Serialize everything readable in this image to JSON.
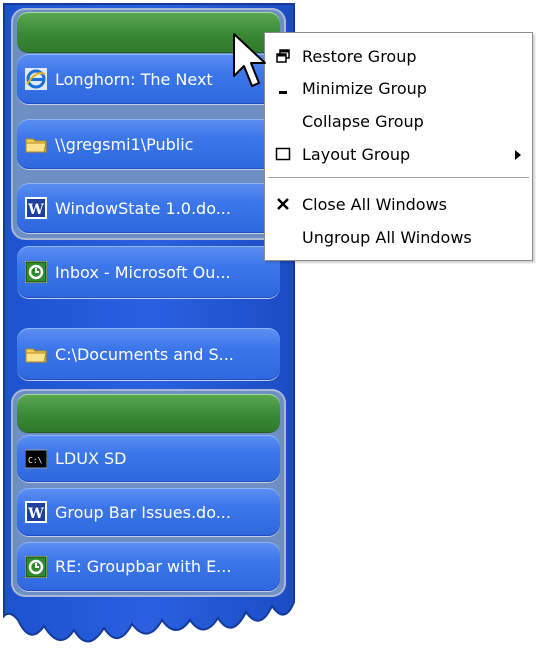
{
  "colors": {
    "taskbar_blue": "#2f68de",
    "group_header_green": "#3a8a35",
    "menu_background": "#ffffff"
  },
  "group_1": {
    "header_label": "",
    "windows": [
      {
        "icon": "internet-explorer-icon",
        "title": "Longhorn: The Next"
      },
      {
        "icon": "folder-icon",
        "title": "\\\\gregsmi1\\Public"
      },
      {
        "icon": "word-document-icon",
        "title": "WindowState 1.0.do..."
      }
    ]
  },
  "standalone_windows": [
    {
      "icon": "outlook-icon",
      "title": "Inbox - Microsoft Ou..."
    },
    {
      "icon": "folder-icon",
      "title": "C:\\Documents and S..."
    }
  ],
  "group_2": {
    "header_label": "",
    "windows": [
      {
        "icon": "command-prompt-icon",
        "title": "LDUX SD"
      },
      {
        "icon": "word-document-icon",
        "title": "Group Bar Issues.do..."
      },
      {
        "icon": "outlook-icon",
        "title": "RE: Groupbar with E..."
      }
    ]
  },
  "context_menu": {
    "items": [
      {
        "label": "Restore Group",
        "icon": "restore-icon"
      },
      {
        "label": "Minimize Group",
        "icon": "minimize-icon"
      },
      {
        "label": "Collapse Group",
        "icon": ""
      },
      {
        "label": "Layout Group",
        "icon": "layout-box-icon",
        "submenu": true
      },
      {
        "label": "Close All Windows",
        "icon": "close-x-icon"
      },
      {
        "label": "Ungroup All Windows",
        "icon": ""
      }
    ],
    "submenu_arrow_icon": "submenu-arrow-icon"
  }
}
